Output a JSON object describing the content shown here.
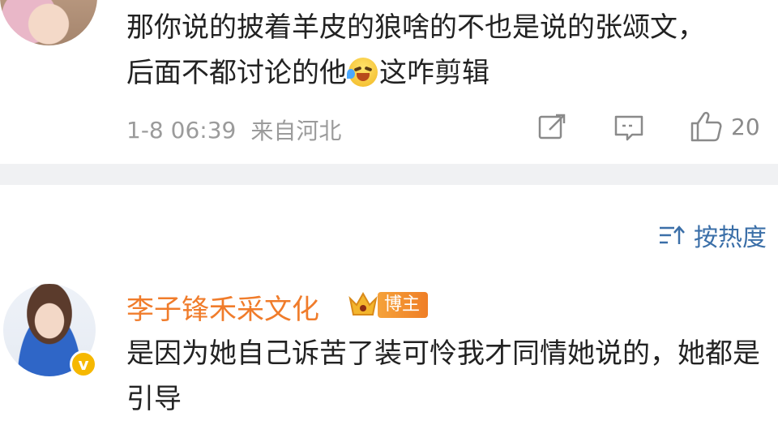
{
  "comment1": {
    "text_part1": "那你说的披着羊皮的狼啥的不也是说的张颂文，后面不都讨论的他",
    "emoji": "crying-laughing-emoji",
    "text_part2": "这咋剪辑",
    "date": "1-8 06:39",
    "location": "来自河北",
    "like_count": "20"
  },
  "sort": {
    "label": "按热度"
  },
  "comment2": {
    "username": "李子锋禾采文化",
    "badge": "博主",
    "verified_icon": "v",
    "text": "是因为她自己诉苦了装可怜我才同情她说的，她都是引导"
  },
  "colors": {
    "username": "#f07c2b",
    "link": "#3b6fa8",
    "meta": "#9b9b9b",
    "divider": "#f0f1f3"
  }
}
